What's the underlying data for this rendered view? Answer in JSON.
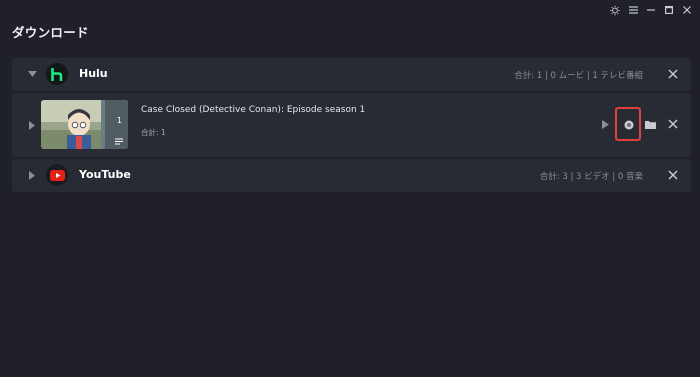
{
  "window": {
    "controls": [
      "theme-icon",
      "menu-icon",
      "minimize-icon",
      "maximize-icon",
      "close-icon"
    ]
  },
  "page": {
    "title": "ダウンロード"
  },
  "services": [
    {
      "name": "Hulu",
      "stats": "合計: 1 | 0 ムービ | 1 テレビ番組",
      "logo_color": "#1ce783",
      "expanded": true,
      "items": [
        {
          "title": "Case Closed (Detective Conan): Episode season 1",
          "count": "合計: 1",
          "thumb_count": "1"
        }
      ]
    },
    {
      "name": "YouTube",
      "stats": "合計: 3 | 3 ビデオ | 0 音楽",
      "logo_color": "#e62117",
      "expanded": false
    }
  ],
  "colors": {
    "background": "#1f2029",
    "panel": "#282a34",
    "highlight": "#e0413d"
  }
}
